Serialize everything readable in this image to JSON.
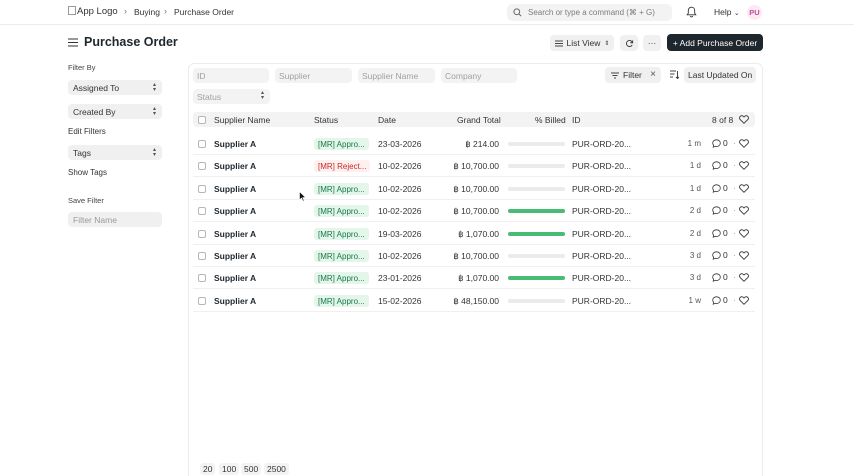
{
  "navbar": {
    "logo_alt": "App Logo",
    "breadcrumbs": [
      "Buying",
      "Purchase Order"
    ],
    "search_placeholder": "Search or type a command (⌘ + G)",
    "help_label": "Help",
    "avatar_initials": "PU"
  },
  "header": {
    "title": "Purchase Order",
    "view_label": "List View",
    "more_label": "···",
    "add_label": "+ Add Purchase Order"
  },
  "sidebar": {
    "filter_by_label": "Filter By",
    "assigned_to": "Assigned To",
    "created_by": "Created By",
    "edit_filters": "Edit Filters",
    "tags": "Tags",
    "show_tags": "Show Tags",
    "save_filter_label": "Save Filter",
    "filter_name_placeholder": "Filter Name"
  },
  "filters": {
    "id_placeholder": "ID",
    "supplier_placeholder": "Supplier",
    "supplier_name_placeholder": "Supplier Name",
    "company_placeholder": "Company",
    "status_placeholder": "Status",
    "filter_label": "Filter",
    "sort_label": "Last Updated On"
  },
  "table": {
    "columns": {
      "supplier_name": "Supplier Name",
      "status": "Status",
      "date": "Date",
      "grand_total": "Grand Total",
      "billed": "% Billed",
      "id": "ID"
    },
    "count": "8 of 8",
    "rows": [
      {
        "supplier": "Supplier A",
        "status": "[MR] Appro...",
        "status_kind": "approved",
        "date": "23-03-2026",
        "total": "฿ 214.00",
        "billed": 0,
        "id": "PUR-ORD-20...",
        "modified": "1 m",
        "comments": "0"
      },
      {
        "supplier": "Supplier A",
        "status": "[MR] Reject...",
        "status_kind": "rejected",
        "date": "10-02-2026",
        "total": "฿ 10,700.00",
        "billed": 0,
        "id": "PUR-ORD-20...",
        "modified": "1 d",
        "comments": "0"
      },
      {
        "supplier": "Supplier A",
        "status": "[MR] Appro...",
        "status_kind": "approved",
        "date": "10-02-2026",
        "total": "฿ 10,700.00",
        "billed": 0,
        "id": "PUR-ORD-20...",
        "modified": "1 d",
        "comments": "0"
      },
      {
        "supplier": "Supplier A",
        "status": "[MR] Appro...",
        "status_kind": "approved",
        "date": "10-02-2026",
        "total": "฿ 10,700.00",
        "billed": 1,
        "id": "PUR-ORD-20...",
        "modified": "2 d",
        "comments": "0"
      },
      {
        "supplier": "Supplier A",
        "status": "[MR] Appro...",
        "status_kind": "approved",
        "date": "19-03-2026",
        "total": "฿ 1,070.00",
        "billed": 1,
        "id": "PUR-ORD-20...",
        "modified": "2 d",
        "comments": "0"
      },
      {
        "supplier": "Supplier A",
        "status": "[MR] Appro...",
        "status_kind": "approved",
        "date": "10-02-2026",
        "total": "฿ 10,700.00",
        "billed": 0,
        "id": "PUR-ORD-20...",
        "modified": "3 d",
        "comments": "0"
      },
      {
        "supplier": "Supplier A",
        "status": "[MR] Appro...",
        "status_kind": "approved",
        "date": "23-01-2026",
        "total": "฿ 1,070.00",
        "billed": 1,
        "id": "PUR-ORD-20...",
        "modified": "3 d",
        "comments": "0"
      },
      {
        "supplier": "Supplier A",
        "status": "[MR] Appro...",
        "status_kind": "approved",
        "date": "15-02-2026",
        "total": "฿ 48,150.00",
        "billed": 0,
        "id": "PUR-ORD-20...",
        "modified": "1 w",
        "comments": "0"
      }
    ]
  },
  "paging": [
    "20",
    "100",
    "500",
    "2500"
  ],
  "colors": {
    "primary_button": "#1f272e",
    "approved_bg": "#e4f5e9",
    "approved_text": "#16794c",
    "rejected_bg": "#fff0f0",
    "rejected_text": "#c52929",
    "billed_fill": "#48bb74"
  }
}
